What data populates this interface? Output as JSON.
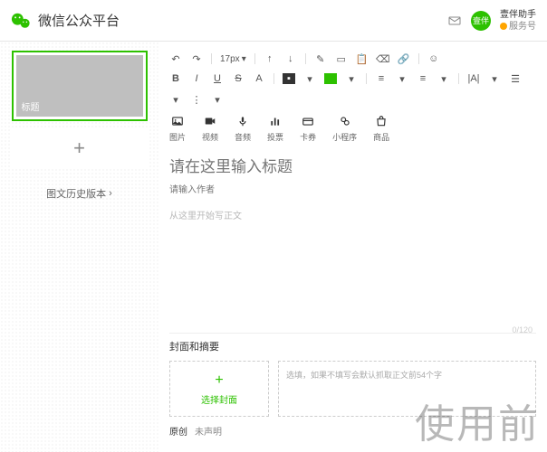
{
  "header": {
    "title": "微信公众平台",
    "user_name": "壹伴助手",
    "user_type": "服务号"
  },
  "sidebar": {
    "thumb_label": "标题",
    "history_link": "图文历史版本"
  },
  "toolbar": {
    "fontsize": "17px"
  },
  "media": {
    "image": "图片",
    "video": "视频",
    "audio": "音频",
    "vote": "投票",
    "card": "卡券",
    "miniapp": "小程序",
    "product": "商品"
  },
  "editor": {
    "title_placeholder": "请在这里输入标题",
    "author_placeholder": "请输入作者",
    "content_placeholder": "从这里开始写正文",
    "char_count": "0/120"
  },
  "cover": {
    "section_title": "封面和摘要",
    "select_label": "选择封面",
    "summary_placeholder": "选填，如果不填写会默认抓取正文前54个字"
  },
  "original": {
    "label": "原创",
    "status": "未声明"
  },
  "watermark": "使用前"
}
